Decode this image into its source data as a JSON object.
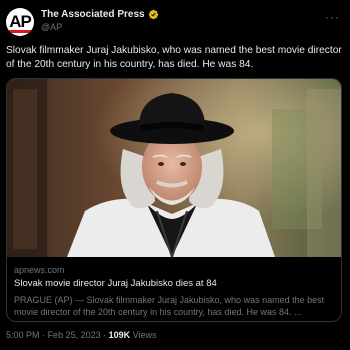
{
  "account": {
    "avatar_text": "AP",
    "display_name": "The Associated Press",
    "handle": "@AP",
    "verified_icon": "verified-badge-icon",
    "more_icon": "more-options-icon"
  },
  "tweet": {
    "text": "Slovak filmmaker Juraj Jakubisko, who was named the best movie director of the 20th century in his country, has died. He was 84."
  },
  "link_card": {
    "domain": "apnews.com",
    "title": "Slovak movie director Juraj Jakubisko dies at 84",
    "description": "PRAGUE (AP) — Slovak filmmaker Juraj Jakubisko, who was named the best movie director of the 20th century in his country, has died. He was 84. ..."
  },
  "footer": {
    "time": "5:00 PM",
    "separator": "·",
    "date": "Feb 25, 2023",
    "views_count": "109K",
    "views_label": "Views"
  },
  "colors": {
    "background": "#000000",
    "verified_gold": "#e2b719",
    "ap_red": "#d71920",
    "muted_text": "#71767b"
  }
}
